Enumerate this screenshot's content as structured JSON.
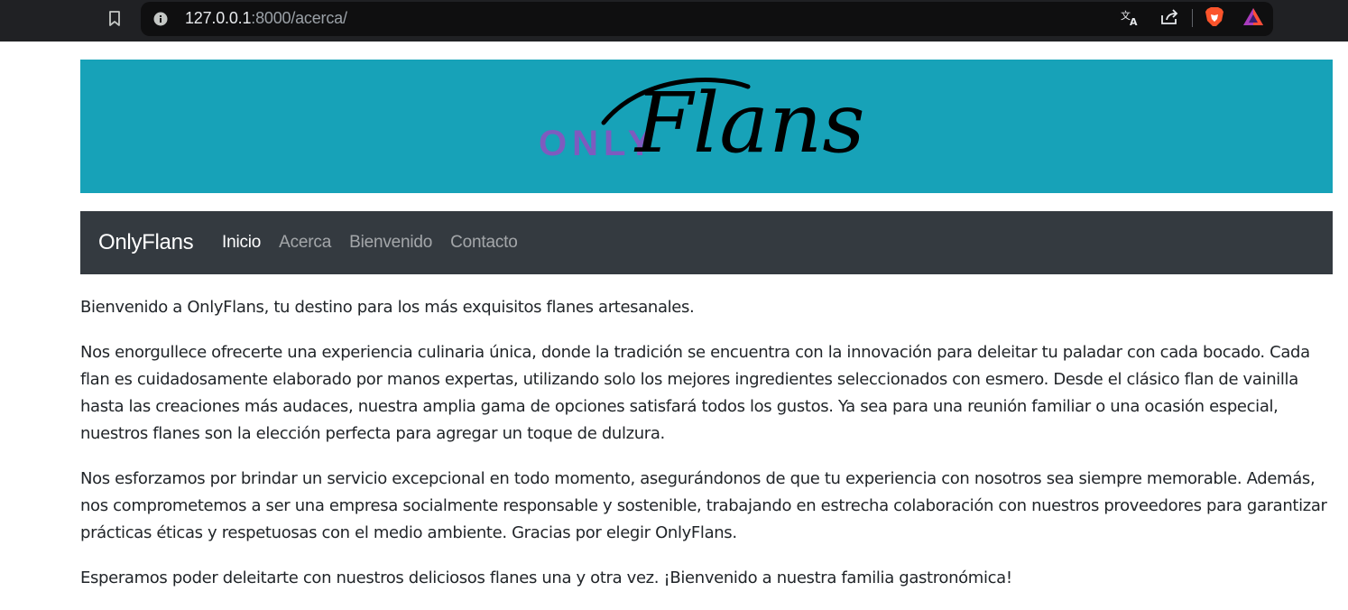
{
  "browser": {
    "url_host": "127.0.0.1",
    "url_rest": ":8000/acerca/",
    "icons": [
      "bookmark-icon",
      "site-info-icon",
      "translate-icon",
      "share-icon",
      "brave-shields-icon",
      "brave-rewards-icon"
    ]
  },
  "banner": {
    "logo_small": "ONLY",
    "logo_script": "Flans",
    "background": "#17a2b8",
    "small_color": "#7e5bbf"
  },
  "navbar": {
    "brand": "OnlyFlans",
    "links": [
      {
        "label": "Inicio",
        "active": true
      },
      {
        "label": "Acerca",
        "active": false
      },
      {
        "label": "Bienvenido",
        "active": false
      },
      {
        "label": "Contacto",
        "active": false
      }
    ],
    "background": "#343a40"
  },
  "content": {
    "paragraphs": [
      "Bienvenido a OnlyFlans, tu destino para los más exquisitos flanes artesanales.",
      "Nos enorgullece ofrecerte una experiencia culinaria única, donde la tradición se encuentra con la innovación para deleitar tu paladar con cada bocado. Cada flan es cuidadosamente elaborado por manos expertas, utilizando solo los mejores ingredientes seleccionados con esmero. Desde el clásico flan de vainilla hasta las creaciones más audaces, nuestra amplia gama de opciones satisfará todos los gustos. Ya sea para una reunión familiar o una ocasión especial, nuestros flanes son la elección perfecta para agregar un toque de dulzura.",
      "Nos esforzamos por brindar un servicio excepcional en todo momento, asegurándonos de que tu experiencia con nosotros sea siempre memorable. Además, nos comprometemos a ser una empresa socialmente responsable y sostenible, trabajando en estrecha colaboración con nuestros proveedores para garantizar prácticas éticas y respetuosas con el medio ambiente. Gracias por elegir OnlyFlans.",
      "Esperamos poder deleitarte con nuestros deliciosos flanes una y otra vez. ¡Bienvenido a nuestra familia gastronómica!"
    ]
  }
}
